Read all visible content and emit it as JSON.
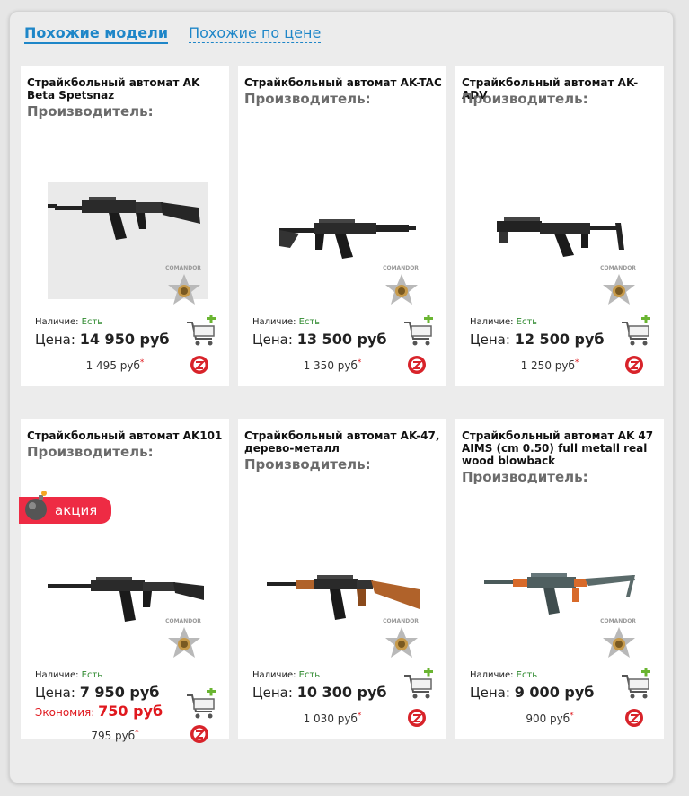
{
  "tabs": [
    {
      "label": "Похожие модели"
    },
    {
      "label": "Похожие по цене"
    }
  ],
  "labels": {
    "maker": "Производитель:",
    "stock": "Наличие:",
    "price": "Цена:",
    "save": "Экономия:",
    "sale": "акция"
  },
  "products": [
    {
      "title": "Страйкбольный автомат AK Beta Spetsnaz",
      "brand": "COMANDOR",
      "stock": "Есть",
      "price": "14 950 руб",
      "bonus": "1 495 руб",
      "bonus_mark": "*"
    },
    {
      "title": "Страйкбольный автомат AK-TAC",
      "brand": "COMANDOR",
      "stock": "Есть",
      "price": "13 500 руб",
      "bonus": "1 350 руб",
      "bonus_mark": "*"
    },
    {
      "title": "Страйкбольный автомат AK-ADV",
      "brand": "COMANDOR",
      "stock": "Есть",
      "price": "12 500 руб",
      "bonus": "1 250 руб",
      "bonus_mark": "*"
    },
    {
      "title": "Страйкбольный автомат AK101",
      "brand": "COMANDOR",
      "stock": "Есть",
      "price": "7 950 руб",
      "saving": "750 руб",
      "bonus": "795 руб",
      "bonus_mark": "*"
    },
    {
      "title": "Страйкбольный автомат AK-47, дерево-металл",
      "brand": "COMANDOR",
      "stock": "Есть",
      "price": "10 300 руб",
      "bonus": "1 030 руб",
      "bonus_mark": "*"
    },
    {
      "title": "Страйкбольный автомат AK 47 AIMS (cm 0.50) full metall real wood blowback",
      "brand": "COMANDOR",
      "stock": "Есть",
      "price": "9 000 руб",
      "bonus": "900 руб",
      "bonus_mark": "*"
    }
  ],
  "colors": {
    "accent": "#1e86c8",
    "in_stock": "#2f8a2f",
    "sale": "#ee2b44",
    "saving": "#e0181e"
  }
}
